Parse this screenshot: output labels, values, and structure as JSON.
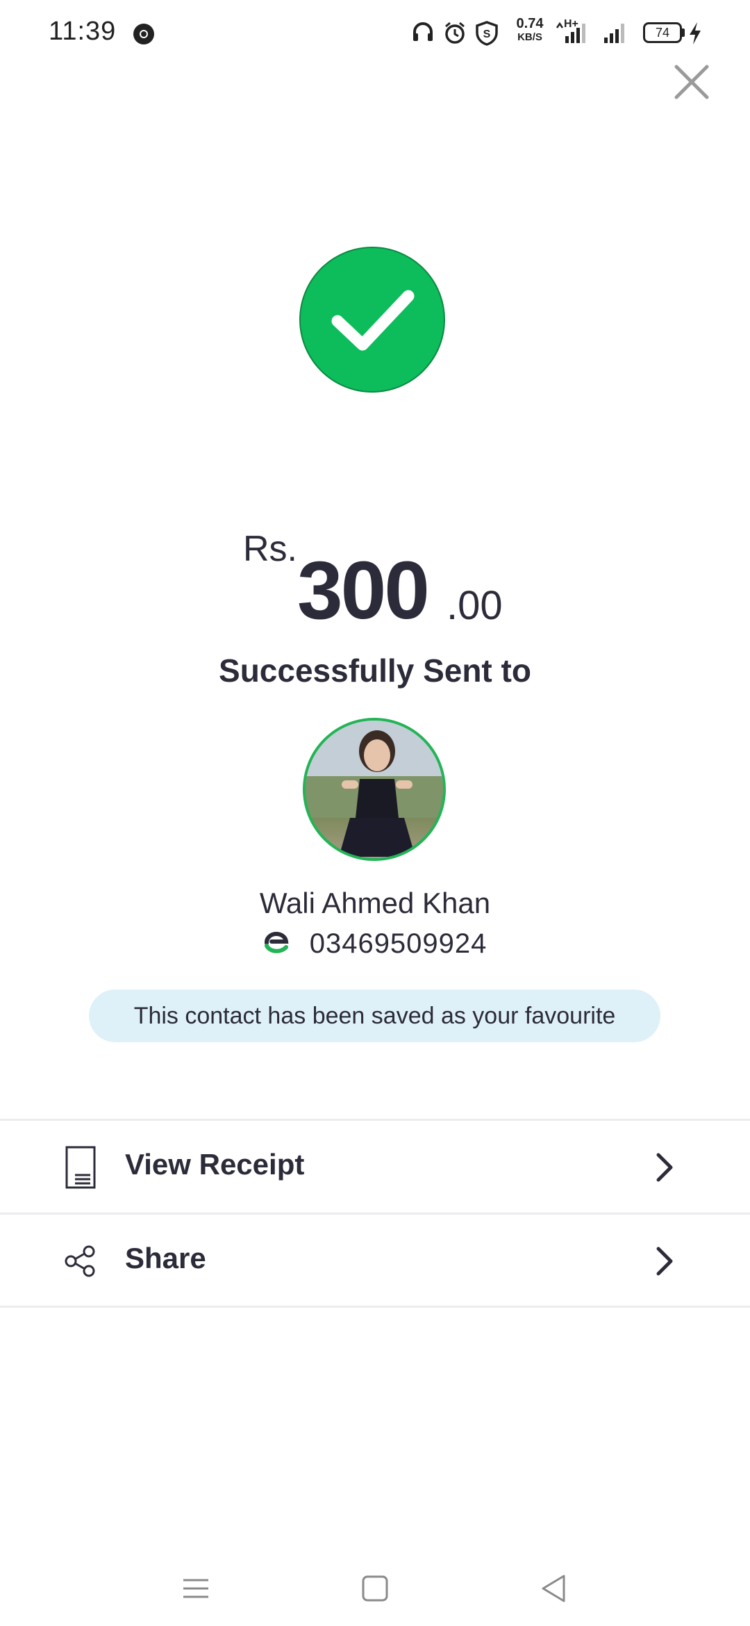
{
  "status_bar": {
    "time": "11:39",
    "net_speed": "0.74",
    "net_speed_unit": "KB/S",
    "network_type": "H+",
    "battery": "74"
  },
  "payment": {
    "currency": "Rs.",
    "amount_whole": "300",
    "amount_decimal": ".00",
    "status_text": "Successfully Sent to"
  },
  "recipient": {
    "name": "Wali Ahmed Khan",
    "phone": "03469509924"
  },
  "favourite_notice": "This contact has been saved as your favourite",
  "actions": [
    {
      "label": "View Receipt",
      "icon": "receipt-icon"
    },
    {
      "label": "Share",
      "icon": "share-icon"
    }
  ],
  "colors": {
    "success_green": "#0dbc5a",
    "text_dark": "#2b2b3a",
    "banner_bg": "#dff1f8",
    "avatar_ring": "#22b455"
  }
}
